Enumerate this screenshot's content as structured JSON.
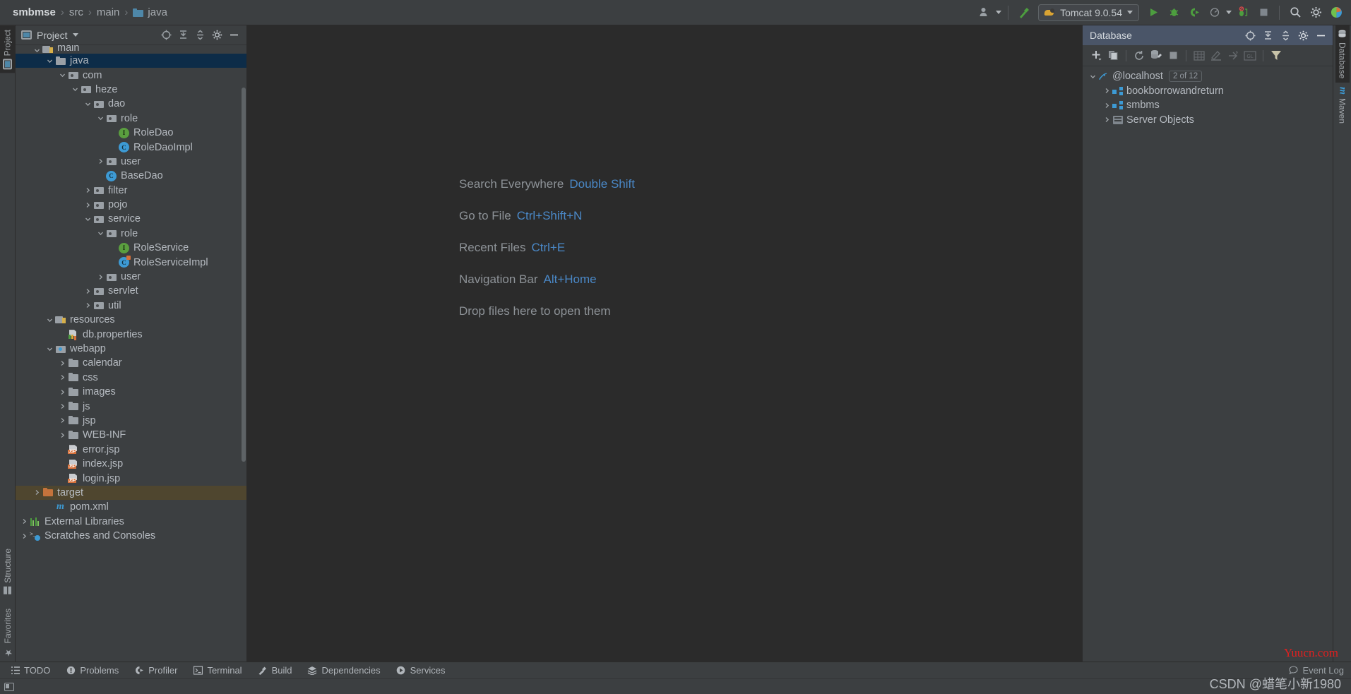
{
  "breadcrumb": {
    "items": [
      {
        "label": "smbmse",
        "icon": "none",
        "bold": true
      },
      {
        "label": "src",
        "icon": "none",
        "bold": false
      },
      {
        "label": "main",
        "icon": "none",
        "bold": false
      },
      {
        "label": "java",
        "icon": "folder-blue",
        "bold": false
      }
    ],
    "separator": "›"
  },
  "toolbar": {
    "account_icon": "user-icon",
    "build_icon": "hammer-icon",
    "run_config": {
      "label": "Tomcat 9.0.54",
      "icon": "tomcat-cat-icon"
    },
    "run_label": "Run",
    "debug_label": "Debug",
    "run_coverage_label": "Run with Coverage",
    "profiler_label": "Profiler",
    "stop_label": "Stop",
    "search_label": "Search",
    "settings_label": "Settings",
    "updates_label": "Updates"
  },
  "left_strip": {
    "top_tabs": [
      {
        "label": "Project",
        "active": true
      }
    ],
    "bottom_tabs": [
      {
        "label": "Structure",
        "active": false
      },
      {
        "label": "Favorites",
        "active": false
      }
    ]
  },
  "right_strip": {
    "tabs": [
      {
        "label": "Database",
        "active": true
      },
      {
        "label": "Maven",
        "active": false
      }
    ]
  },
  "project_panel": {
    "title": "Project",
    "dropdown_icon": "chevron-down-icon",
    "actions": [
      "locate-icon",
      "expand-all-icon",
      "collapse-all-icon",
      "settings-icon",
      "hide-icon"
    ],
    "tree": [
      {
        "label": "main",
        "depth": 1,
        "arrow": "down",
        "icon": "src-folder",
        "state": "clipped"
      },
      {
        "label": "java",
        "depth": 2,
        "arrow": "down",
        "icon": "folder-blue",
        "state": "selected"
      },
      {
        "label": "com",
        "depth": 3,
        "arrow": "down",
        "icon": "package"
      },
      {
        "label": "heze",
        "depth": 4,
        "arrow": "down",
        "icon": "package"
      },
      {
        "label": "dao",
        "depth": 5,
        "arrow": "down",
        "icon": "package"
      },
      {
        "label": "role",
        "depth": 6,
        "arrow": "down",
        "icon": "package"
      },
      {
        "label": "RoleDao",
        "depth": 7,
        "arrow": "none",
        "icon": "interface"
      },
      {
        "label": "RoleDaoImpl",
        "depth": 7,
        "arrow": "none",
        "icon": "class"
      },
      {
        "label": "user",
        "depth": 6,
        "arrow": "right",
        "icon": "package"
      },
      {
        "label": "BaseDao",
        "depth": 6,
        "arrow": "none",
        "icon": "class"
      },
      {
        "label": "filter",
        "depth": 5,
        "arrow": "right",
        "icon": "package"
      },
      {
        "label": "pojo",
        "depth": 5,
        "arrow": "right",
        "icon": "package"
      },
      {
        "label": "service",
        "depth": 5,
        "arrow": "down",
        "icon": "package"
      },
      {
        "label": "role",
        "depth": 6,
        "arrow": "down",
        "icon": "package"
      },
      {
        "label": "RoleService",
        "depth": 7,
        "arrow": "none",
        "icon": "interface"
      },
      {
        "label": "RoleServiceImpl",
        "depth": 7,
        "arrow": "none",
        "icon": "class-impl"
      },
      {
        "label": "user",
        "depth": 6,
        "arrow": "right",
        "icon": "package"
      },
      {
        "label": "servlet",
        "depth": 5,
        "arrow": "right",
        "icon": "package"
      },
      {
        "label": "util",
        "depth": 5,
        "arrow": "right",
        "icon": "package"
      },
      {
        "label": "resources",
        "depth": 2,
        "arrow": "down",
        "icon": "resources-folder"
      },
      {
        "label": "db.properties",
        "depth": 3,
        "arrow": "none",
        "icon": "properties-file"
      },
      {
        "label": "webapp",
        "depth": 2,
        "arrow": "down",
        "icon": "web-folder"
      },
      {
        "label": "calendar",
        "depth": 3,
        "arrow": "right",
        "icon": "plain-folder"
      },
      {
        "label": "css",
        "depth": 3,
        "arrow": "right",
        "icon": "plain-folder"
      },
      {
        "label": "images",
        "depth": 3,
        "arrow": "right",
        "icon": "plain-folder"
      },
      {
        "label": "js",
        "depth": 3,
        "arrow": "right",
        "icon": "plain-folder"
      },
      {
        "label": "jsp",
        "depth": 3,
        "arrow": "right",
        "icon": "plain-folder"
      },
      {
        "label": "WEB-INF",
        "depth": 3,
        "arrow": "right",
        "icon": "plain-folder"
      },
      {
        "label": "error.jsp",
        "depth": 3,
        "arrow": "none",
        "icon": "jsp-file"
      },
      {
        "label": "index.jsp",
        "depth": 3,
        "arrow": "none",
        "icon": "jsp-file"
      },
      {
        "label": "login.jsp",
        "depth": 3,
        "arrow": "none",
        "icon": "jsp-file"
      },
      {
        "label": "target",
        "depth": 1,
        "arrow": "right",
        "icon": "excluded-folder",
        "state": "highlighted"
      },
      {
        "label": "pom.xml",
        "depth": 2,
        "arrow": "none",
        "icon": "maven-file"
      },
      {
        "label": "External Libraries",
        "depth": 0,
        "arrow": "right",
        "icon": "library-icon"
      },
      {
        "label": "Scratches and Consoles",
        "depth": 0,
        "arrow": "right",
        "icon": "scratches-icon"
      }
    ]
  },
  "editor": {
    "tips": [
      {
        "action": "Search Everywhere",
        "shortcut": "Double Shift"
      },
      {
        "action": "Go to File",
        "shortcut": "Ctrl+Shift+N"
      },
      {
        "action": "Recent Files",
        "shortcut": "Ctrl+E"
      },
      {
        "action": "Navigation Bar",
        "shortcut": "Alt+Home"
      },
      {
        "action": "Drop files here to open them",
        "shortcut": ""
      }
    ]
  },
  "database_panel": {
    "title": "Database",
    "header_actions": [
      "locate-icon",
      "expand-all-icon",
      "collapse-all-icon",
      "settings-icon",
      "hide-icon"
    ],
    "toolbar_actions": [
      "add-icon",
      "duplicate-icon",
      "refresh-icon",
      "run-sql-icon",
      "stop-icon",
      "table-icon",
      "modify-icon",
      "jump-icon",
      "gql-icon",
      "filter-icon"
    ],
    "tree": [
      {
        "label": "@localhost",
        "depth": 0,
        "arrow": "down",
        "icon": "mysql-icon",
        "badge": "2 of 12"
      },
      {
        "label": "bookborrowandreturn",
        "depth": 1,
        "arrow": "right",
        "icon": "schema-icon",
        "badge": ""
      },
      {
        "label": "smbms",
        "depth": 1,
        "arrow": "right",
        "icon": "schema-icon",
        "badge": ""
      },
      {
        "label": "Server Objects",
        "depth": 1,
        "arrow": "right",
        "icon": "server-objects-icon",
        "badge": ""
      }
    ]
  },
  "bottom_bar": {
    "items": [
      {
        "label": "TODO",
        "icon": "todo-icon"
      },
      {
        "label": "Problems",
        "icon": "problems-icon"
      },
      {
        "label": "Profiler",
        "icon": "profiler-icon"
      },
      {
        "label": "Terminal",
        "icon": "terminal-icon"
      },
      {
        "label": "Build",
        "icon": "build-icon"
      },
      {
        "label": "Dependencies",
        "icon": "dependencies-icon"
      },
      {
        "label": "Services",
        "icon": "services-icon"
      }
    ],
    "event_log": {
      "label": "Event Log",
      "icon": "balloon-icon"
    }
  },
  "watermarks": {
    "site": "Yuucn.com",
    "author": "CSDN @蜡笔小新1980"
  },
  "colors": {
    "panel_bg": "#3c3f41",
    "editor_bg": "#2b2b2b",
    "selection_blue": "#0d2c48",
    "db_header": "#4a5568",
    "accent_blue": "#4a88c7",
    "text": "#b5bac0",
    "watermark_red": "#e02020"
  }
}
